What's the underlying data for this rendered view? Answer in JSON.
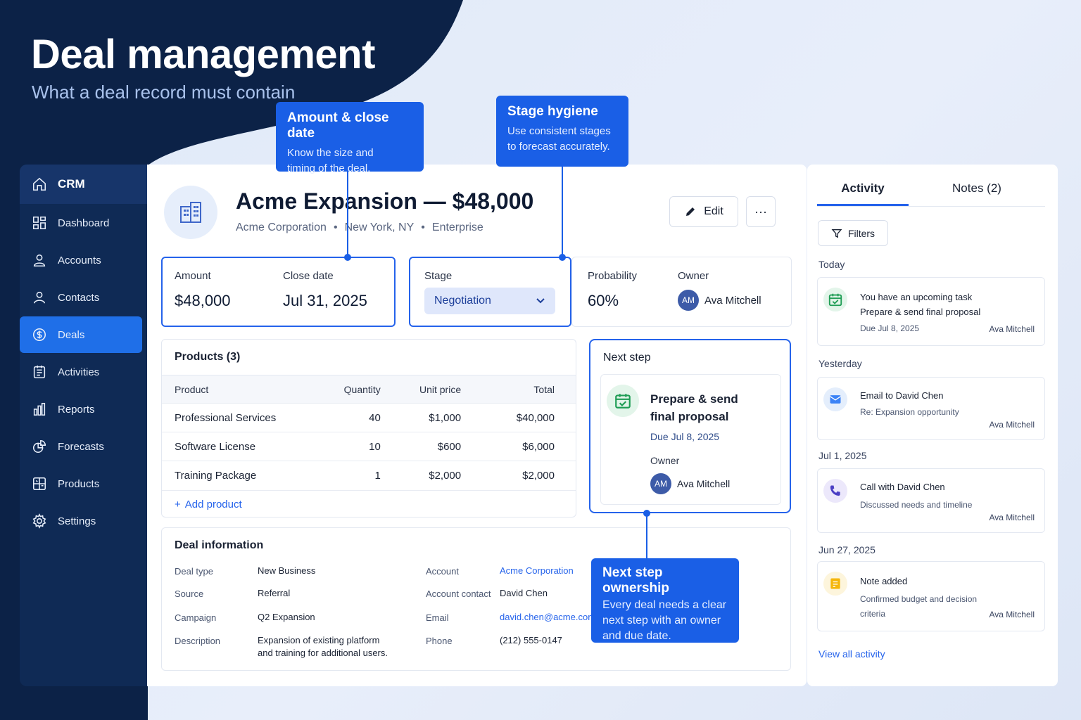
{
  "hero": {
    "title": "Deal management",
    "subtitle": "What a deal record must contain"
  },
  "sidebar": {
    "app_name": "CRM",
    "items": [
      {
        "label": "Dashboard",
        "icon": "dashboard-icon"
      },
      {
        "label": "Accounts",
        "icon": "user-icon"
      },
      {
        "label": "Contacts",
        "icon": "contact-icon"
      },
      {
        "label": "Deals",
        "icon": "dollar-icon",
        "active": true
      },
      {
        "label": "Activities",
        "icon": "clipboard-icon"
      },
      {
        "label": "Reports",
        "icon": "bar-chart-icon"
      },
      {
        "label": "Forecasts",
        "icon": "forecast-icon"
      },
      {
        "label": "Products",
        "icon": "box-icon"
      },
      {
        "label": "Settings",
        "icon": "gear-icon"
      }
    ]
  },
  "deal": {
    "title": "Acme Expansion — $48,000",
    "company": "Acme Corporation",
    "location": "New York, NY",
    "segment": "Enterprise",
    "edit_label": "Edit",
    "more_label": "···",
    "amount_label": "Amount",
    "amount": "$48,000",
    "close_label": "Close date",
    "close_date": "Jul 31, 2025",
    "stage_label": "Stage",
    "stage": "Negotiation",
    "probability_label": "Probability",
    "probability": "60%",
    "owner_label": "Owner",
    "owner_initials": "AM",
    "owner": "Ava Mitchell"
  },
  "products": {
    "title": "Products (3)",
    "columns": [
      "Product",
      "Quantity",
      "Unit price",
      "Total"
    ],
    "rows": [
      {
        "product": "Professional Services",
        "quantity": "40",
        "unit_price": "$1,000",
        "total": "$40,000"
      },
      {
        "product": "Software License",
        "quantity": "10",
        "unit_price": "$600",
        "total": "$6,000"
      },
      {
        "product": "Training Package",
        "quantity": "1",
        "unit_price": "$2,000",
        "total": "$2,000"
      }
    ],
    "add_label": "Add product"
  },
  "next_step": {
    "heading": "Next step",
    "title": "Prepare & send final proposal",
    "due": "Due Jul 8, 2025",
    "owner_label": "Owner",
    "owner_initials": "AM",
    "owner": "Ava Mitchell"
  },
  "deal_info": {
    "title": "Deal information",
    "deal_type_label": "Deal type",
    "deal_type": "New Business",
    "source_label": "Source",
    "source": "Referral",
    "campaign_label": "Campaign",
    "campaign": "Q2 Expansion",
    "description_label": "Description",
    "description_1": "Expansion of existing platform",
    "description_2": "and training for additional users.",
    "account_label": "Account",
    "account": "Acme Corporation",
    "contact_label": "Account contact",
    "contact": "David Chen",
    "email_label": "Email",
    "email": "david.chen@acme.com",
    "phone_label": "Phone",
    "phone": "(212) 555-0147"
  },
  "activity": {
    "tab_activity": "Activity",
    "tab_notes": "Notes (2)",
    "filters_label": "Filters",
    "groups": [
      "Today",
      "Yesterday",
      "Jul 1, 2025",
      "Jun 27, 2025"
    ],
    "items": [
      {
        "line1": "You have an upcoming task",
        "line2": "Prepare & send final proposal",
        "sub": "Due Jul 8, 2025",
        "owner": "Ava Mitchell"
      },
      {
        "line1": "Email to David Chen",
        "sub": "Re: Expansion opportunity",
        "owner": "Ava Mitchell"
      },
      {
        "line1": "Call with David Chen",
        "sub": "Discussed needs and timeline",
        "owner": "Ava Mitchell"
      },
      {
        "line1": "Note added",
        "sub1": "Confirmed budget and decision",
        "sub2": "criteria",
        "owner": "Ava Mitchell"
      }
    ],
    "view_all": "View all activity"
  },
  "callouts": {
    "amount": {
      "title": "Amount & close date",
      "body1": "Know the size and",
      "body2": "timing of the deal."
    },
    "stage": {
      "title": "Stage hygiene",
      "body1": "Use consistent stages",
      "body2": "to forecast accurately."
    },
    "next": {
      "title": "Next step ownership",
      "body1": "Every deal needs a clear",
      "body2": "next step with an owner",
      "body3": "and due date."
    }
  },
  "colors": {
    "navy": "#0c2247",
    "accent": "#1f6fe8",
    "callout": "#1a5fe6"
  }
}
